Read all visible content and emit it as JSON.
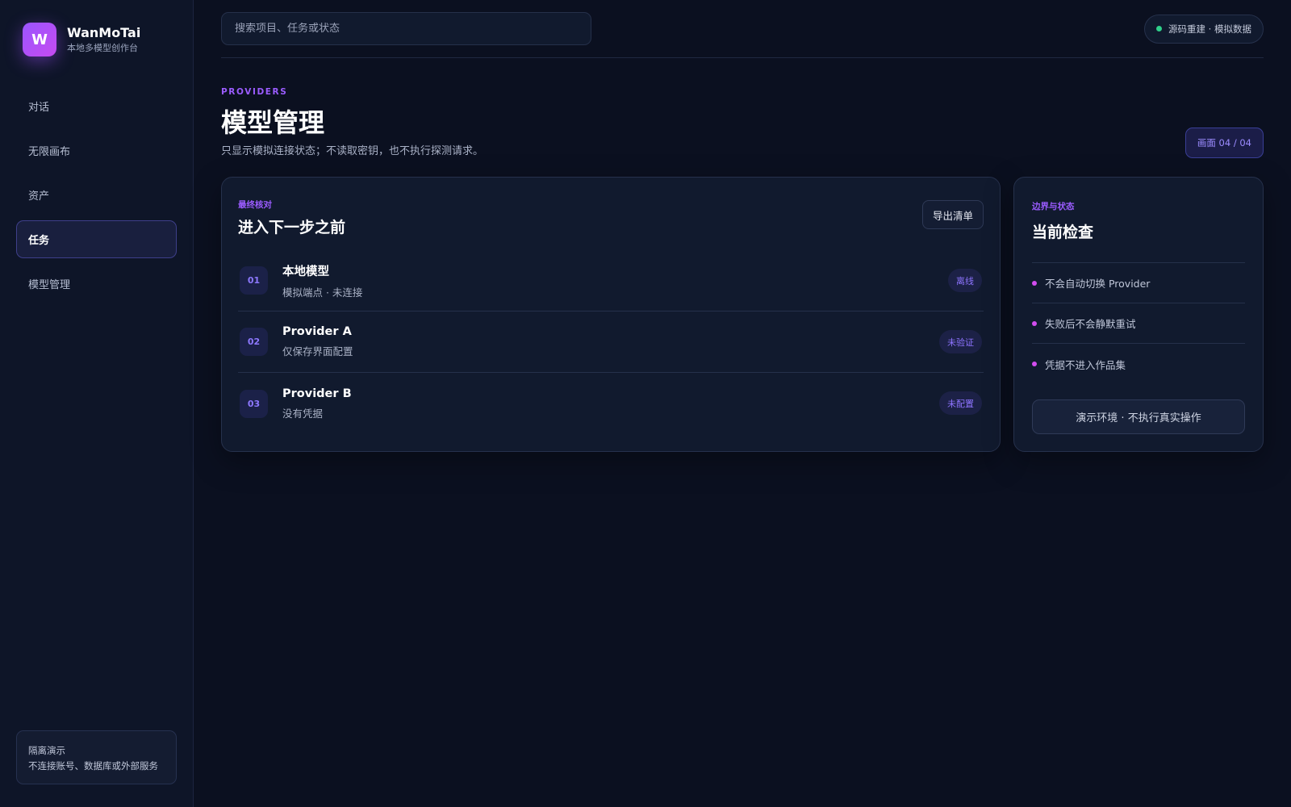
{
  "brand": {
    "logo_letter": "W",
    "title": "WanMoTai",
    "subtitle": "本地多模型创作台"
  },
  "sidebar": {
    "items": [
      {
        "label": "对话",
        "active": false
      },
      {
        "label": "无限画布",
        "active": false
      },
      {
        "label": "资产",
        "active": false
      },
      {
        "label": "任务",
        "active": true
      },
      {
        "label": "模型管理",
        "active": false
      }
    ],
    "note": {
      "title": "隔离演示",
      "text": "不连接账号、数据库或外部服务"
    }
  },
  "topbar": {
    "search_placeholder": "搜索项目、任务或状态",
    "status_text": "源码重建 · 模拟数据",
    "status_color": "#2fd08a"
  },
  "header": {
    "eyebrow": "PROVIDERS",
    "title": "模型管理",
    "description": "只显示模拟连接状态；不读取密钥，也不执行探测请求。",
    "page_indicator": "画面 04 / 04"
  },
  "main_card": {
    "eyebrow": "最终核对",
    "title": "进入下一步之前",
    "export_label": "导出清单",
    "rows": [
      {
        "num": "01",
        "title": "本地模型",
        "subtitle": "模拟端点 · 未连接",
        "badge": "离线"
      },
      {
        "num": "02",
        "title": "Provider A",
        "subtitle": "仅保存界面配置",
        "badge": "未验证"
      },
      {
        "num": "03",
        "title": "Provider B",
        "subtitle": "没有凭据",
        "badge": "未配置"
      }
    ]
  },
  "side_card": {
    "eyebrow": "边界与状态",
    "title": "当前检查",
    "checks": [
      "不会自动切换 Provider",
      "失败后不会静默重试",
      "凭据不进入作品集"
    ],
    "button_label": "演示环境 · 不执行真实操作"
  },
  "colors": {
    "background": "#0b1020",
    "accent": "#9b5cff",
    "bullet": "#d34df0"
  }
}
